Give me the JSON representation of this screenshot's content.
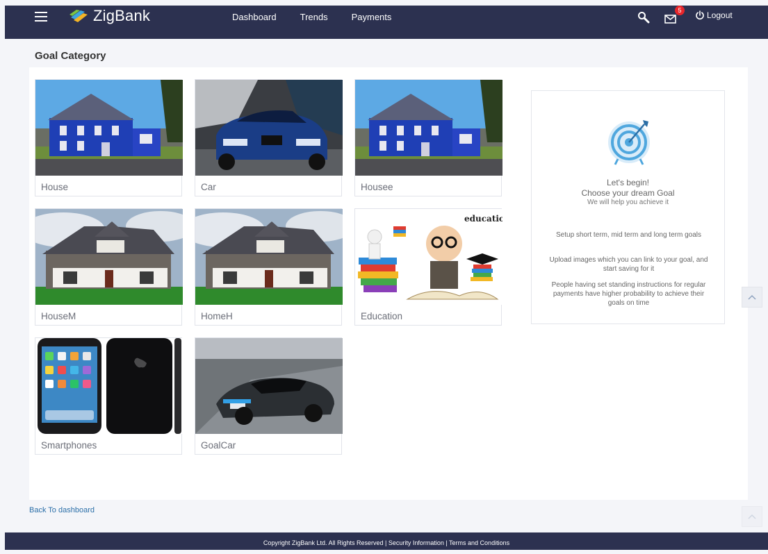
{
  "header": {
    "brand": "ZigBank",
    "nav": [
      "Dashboard",
      "Trends",
      "Payments"
    ],
    "mail_badge": "5",
    "logout_label": "Logout"
  },
  "page": {
    "title": "Goal Category"
  },
  "goals": [
    {
      "label": "House",
      "image": "blue-house"
    },
    {
      "label": "Car",
      "image": "blue-car"
    },
    {
      "label": "Housee",
      "image": "blue-house"
    },
    {
      "label": "HouseM",
      "image": "grey-house"
    },
    {
      "label": "HomeH",
      "image": "grey-house"
    },
    {
      "label": "Education",
      "image": "education",
      "image_text": "education"
    },
    {
      "label": "Smartphones",
      "image": "smartphones"
    },
    {
      "label": "GoalCar",
      "image": "sports-car"
    }
  ],
  "side_panel": {
    "title": "Let's begin!",
    "subtitle": "Choose your dream Goal",
    "tagline": "We will help you achieve it",
    "info": [
      "Setup short term, mid term and long term goals",
      "Upload images which you can link to your goal, and start saving for it",
      "People having set standing instructions for regular payments have higher probability to achieve their goals on time"
    ]
  },
  "back_link": "Back To dashboard",
  "footer": "Copyright ZigBank Ltd. All Rights Reserved | Security Information | Terms and Conditions",
  "colors": {
    "header_bg": "#2c3150",
    "link": "#2b6fa8",
    "badge": "#e8262b",
    "accent": "#4fa7de"
  }
}
